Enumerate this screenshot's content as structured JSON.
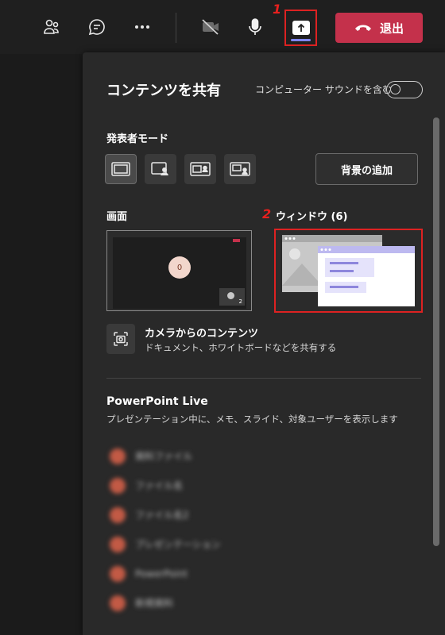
{
  "toolbar": {
    "leave_label": "退出",
    "leave_color": "#c4314b",
    "icons": [
      "people-icon",
      "chat-icon",
      "more-icon",
      "camera-off-icon",
      "mic-icon",
      "share-icon",
      "hangup-icon"
    ]
  },
  "annotations": {
    "step1": "1",
    "step2": "2"
  },
  "panel": {
    "title": "コンテンツを共有",
    "computer_sound_label": "コンピューター サウンドを含む",
    "computer_sound_on": false,
    "presenter_mode_label": "発表者モード",
    "background_button": "背景の追加",
    "screen_label": "画面",
    "window_label": "ウィンドウ (6)",
    "camera_content": {
      "title": "カメラからのコンテンツ",
      "subtitle": "ドキュメント、ホワイトボードなどを共有する"
    },
    "powerpoint": {
      "title": "PowerPoint Live",
      "subtitle": "プレゼンテーション中に、メモ、スライド、対象ユーザーを表示します",
      "files": [
        {
          "name": "資料ファイル"
        },
        {
          "name": "ファイル名"
        },
        {
          "name": "ファイル名2"
        },
        {
          "name": "プレゼンテーション"
        },
        {
          "name": "PowerPoint"
        },
        {
          "name": "新規資料"
        }
      ]
    },
    "screen_thumb": {
      "avatar_initial": "0",
      "tile_count": "2"
    }
  }
}
